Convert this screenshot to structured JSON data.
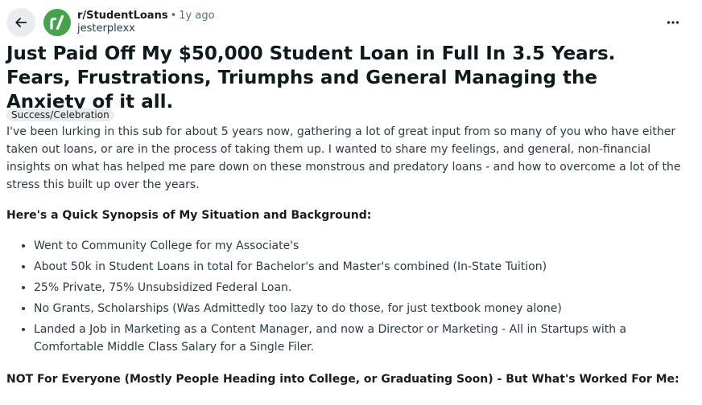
{
  "post": {
    "subreddit": "r/StudentLoans",
    "separator": "•",
    "time_ago": "1y ago",
    "author": "jesterplexx",
    "title": "Just Paid Off My $50,000 Student Loan in Full In 3.5 Years. Fears, Frustrations, Triumphs and General Managing the Anxiety of it all.",
    "flair": "Success/Celebration",
    "intro": "I've been lurking in this sub for about 5 years now, gathering a lot of great input from so many of you who have either taken out loans, or are in the process of taking them up. I wanted to share my feelings, and general, non-financial insights on what has helped me pare down on these monstrous and predatory loans - and how to overcome a lot of the stress this built up over the years.",
    "synopsis_heading": "Here's a Quick Synopsis of My Situation and Background:",
    "bullets": [
      "Went to Community College for my Associate's",
      "About 50k in Student Loans in total for Bachelor's and Master's combined (In-State Tuition)",
      "25% Private, 75% Unsubsidized Federal Loan.",
      "No Grants, Scholarships (Was Admittedly too lazy to do those, for just textbook money alone)",
      "Landed a Job in Marketing as a Content Manager, and now a Director or Marketing - All in Startups with a Comfortable Middle Class Salary for a Single Filer."
    ],
    "second_heading": "NOT For Everyone (Mostly People Heading into College, or Graduating Soon) - But What's Worked For Me:"
  },
  "icons": {
    "back": "arrow-left-icon",
    "subreddit": "subreddit-logo-icon",
    "more": "more-horizontal-icon"
  },
  "colors": {
    "avatar_bg": "#46a34b",
    "button_bg": "#eaedef",
    "meta_text": "#576f76"
  }
}
